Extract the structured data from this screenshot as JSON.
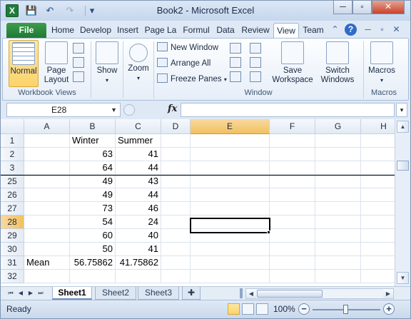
{
  "title": "Book2  -  Microsoft Excel",
  "app_icon_letter": "X",
  "qat": {
    "save": "💾",
    "undo": "↶",
    "redo": "↷",
    "customize": "▾"
  },
  "window_controls": {
    "minimize": "─",
    "maximize": "▫",
    "close": "✕"
  },
  "tabs": [
    "File",
    "Home",
    "Develop",
    "Insert",
    "Page La",
    "Formul",
    "Data",
    "Review",
    "View",
    "Team"
  ],
  "active_tab": "View",
  "ribbon": {
    "workbook_views": {
      "label": "Workbook Views",
      "normal": "Normal",
      "page_layout_1": "Page",
      "page_layout_2": "Layout"
    },
    "show": {
      "label": "Show"
    },
    "zoom": {
      "label": "Zoom"
    },
    "window": {
      "label": "Window",
      "new_window": "New Window",
      "arrange_all": "Arrange All",
      "freeze_panes": "Freeze Panes",
      "save_workspace_1": "Save",
      "save_workspace_2": "Workspace",
      "switch_windows_1": "Switch",
      "switch_windows_2": "Windows"
    },
    "macros": {
      "label": "Macros",
      "button": "Macros"
    }
  },
  "formula_bar": {
    "name_box": "E28",
    "fx": "fx",
    "value": ""
  },
  "columns": [
    "A",
    "B",
    "C",
    "D",
    "E",
    "F",
    "G",
    "H"
  ],
  "selected_column": "E",
  "rows": [
    {
      "num": "1",
      "A": "",
      "B": "Winter",
      "C": "Summer"
    },
    {
      "num": "2",
      "A": "",
      "B": "63",
      "C": "41"
    },
    {
      "num": "3",
      "A": "",
      "B": "64",
      "C": "44"
    },
    {
      "num": "25",
      "A": "",
      "B": "49",
      "C": "43"
    },
    {
      "num": "26",
      "A": "",
      "B": "49",
      "C": "44"
    },
    {
      "num": "27",
      "A": "",
      "B": "73",
      "C": "46"
    },
    {
      "num": "28",
      "A": "",
      "B": "54",
      "C": "24"
    },
    {
      "num": "29",
      "A": "",
      "B": "60",
      "C": "40"
    },
    {
      "num": "30",
      "A": "",
      "B": "50",
      "C": "41"
    },
    {
      "num": "31",
      "A": "Mean",
      "B": "56.75862",
      "C": "41.75862"
    },
    {
      "num": "32",
      "A": "",
      "B": "",
      "C": ""
    }
  ],
  "selected_row": "28",
  "sheets": [
    "Sheet1",
    "Sheet2",
    "Sheet3"
  ],
  "active_sheet": "Sheet1",
  "status": {
    "text": "Ready",
    "zoom": "100%"
  }
}
